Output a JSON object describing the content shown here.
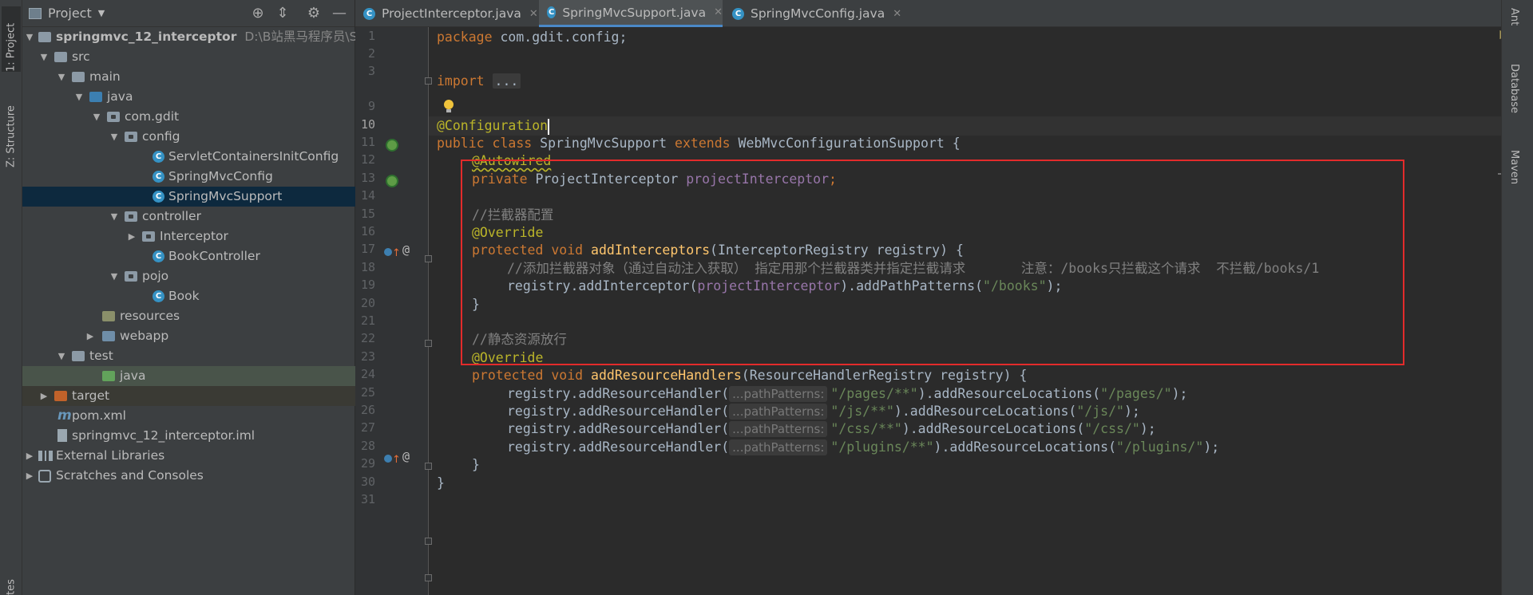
{
  "tool_strip": {
    "project_tab": "1: Project",
    "structure_tab": "Z: Structure",
    "bottom_tab": "tes"
  },
  "project_panel": {
    "title": "Project",
    "tree": [
      {
        "label": "springmvc_12_interceptor",
        "path": "D:\\B站黑马程序员\\SSM框"
      },
      {
        "label": "src"
      },
      {
        "label": "main"
      },
      {
        "label": "java"
      },
      {
        "label": "com.gdit"
      },
      {
        "label": "config"
      },
      {
        "label": "ServletContainersInitConfig"
      },
      {
        "label": "SpringMvcConfig"
      },
      {
        "label": "SpringMvcSupport"
      },
      {
        "label": "controller"
      },
      {
        "label": "Interceptor"
      },
      {
        "label": "BookController"
      },
      {
        "label": "pojo"
      },
      {
        "label": "Book"
      },
      {
        "label": "resources"
      },
      {
        "label": "webapp"
      },
      {
        "label": "test"
      },
      {
        "label": "java"
      },
      {
        "label": "target"
      },
      {
        "label": "pom.xml"
      },
      {
        "label": "springmvc_12_interceptor.iml"
      },
      {
        "label": "External Libraries"
      },
      {
        "label": "Scratches and Consoles"
      }
    ]
  },
  "tabs": [
    {
      "label": "ProjectInterceptor.java"
    },
    {
      "label": "SpringMvcSupport.java"
    },
    {
      "label": "SpringMvcConfig.java"
    }
  ],
  "right_strip": [
    "Ant",
    "Database",
    "Maven"
  ],
  "editor": {
    "line_numbers": [
      "1",
      "2",
      "3",
      "9",
      "10",
      "11",
      "12",
      "13",
      "14",
      "15",
      "16",
      "17",
      "18",
      "19",
      "20",
      "21",
      "22",
      "23",
      "24",
      "25",
      "26",
      "27",
      "28",
      "29",
      "30",
      "31"
    ],
    "code": {
      "l1_kw": "package",
      "l1_rest": " com.gdit.config;",
      "l3_kw": "import",
      "l3_fold": "...",
      "l10_ann": "@Configuration",
      "l11_kw1": "public class",
      "l11_name": " SpringMvcSupport ",
      "l11_kw2": "extends",
      "l11_rest": " WebMvcConfigurationSupport {",
      "l12_ann": "@Autowired",
      "l13_kw": "private",
      "l13_type": " ProjectInterceptor ",
      "l13_fld": "projectInterceptor",
      "l13_end": ";",
      "l15_cmt": "//拦截器配置",
      "l16_ann": "@Override",
      "l17_kw": "protected void",
      "l17_mth": "addInterceptors",
      "l17_rest": "(InterceptorRegistry registry) {",
      "l18_cmt": "//添加拦截器对象（通过自动注入获取） 指定用那个拦截器类并指定拦截请求       注意：/books只拦截这个请求  不拦截/books/1",
      "l19_a": "registry.addInterceptor(",
      "l19_fld": "projectInterceptor",
      "l19_b": ").addPathPatterns(",
      "l19_str": "\"/books\"",
      "l19_c": ");",
      "l20": "}",
      "l22_cmt": "//静态资源放行",
      "l23_ann": "@Override",
      "l24_kw": "protected void",
      "l24_mth": "addResourceHandlers",
      "l24_rest": "(ResourceHandlerRegistry registry) {",
      "handler_call": "registry.addResourceHandler(",
      "hint": "...pathPatterns:",
      "locations_call": ").addResourceLocations(",
      "close_call": ");",
      "l25_s1": "\"/pages/**\"",
      "l25_s2": "\"/pages/\"",
      "l26_s1": "\"/js/**\"",
      "l26_s2": "\"/js/\"",
      "l27_s1": "\"/css/**\"",
      "l27_s2": "\"/css/\"",
      "l28_s1": "\"/plugins/**\"",
      "l28_s2": "\"/plugins/\"",
      "l29": "}",
      "l30": "}"
    }
  },
  "colors": {
    "keyword": "#cc7832",
    "annotation": "#bbb529",
    "comment": "#808080",
    "string": "#6a8759",
    "field": "#9876aa",
    "method": "#ffc66d",
    "highlight_box": "#e32b2b"
  }
}
